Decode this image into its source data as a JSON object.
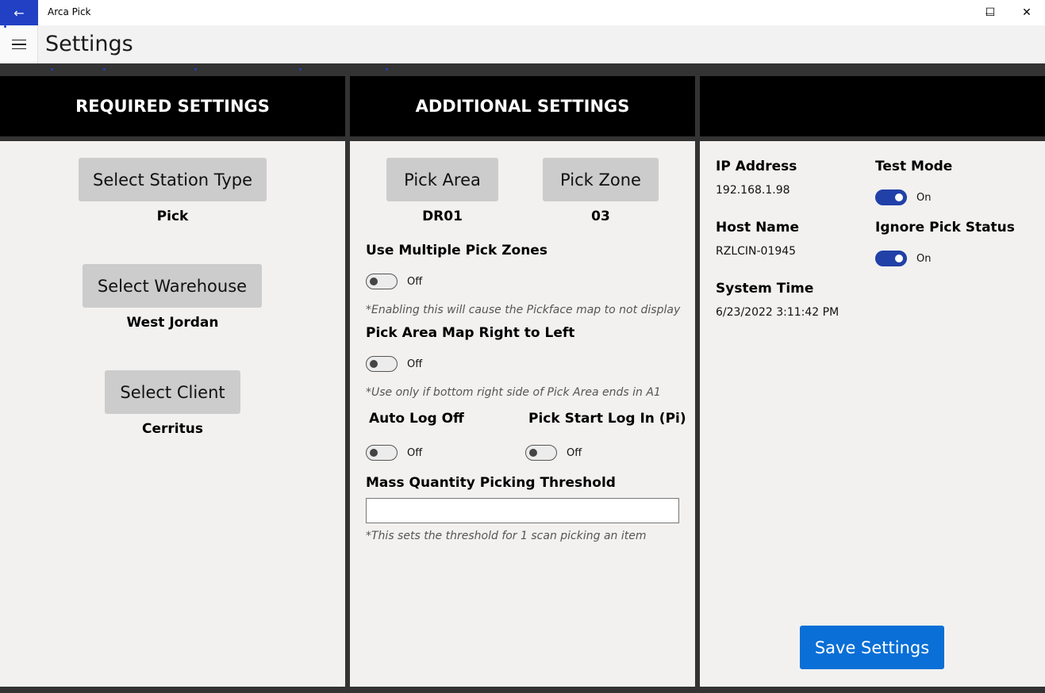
{
  "window": {
    "app_title": "Arca Pick",
    "back_icon": "arrow-left-icon",
    "minimize_icon": "minimize-icon",
    "maximize_icon": "maximize-icon",
    "close_icon": "close-icon",
    "back_glyph": "←",
    "minimize_glyph": "—",
    "maximize_glyph": "☐",
    "close_glyph": "✕"
  },
  "header": {
    "menu_icon": "hamburger-icon",
    "title": "Settings"
  },
  "required": {
    "heading": "REQUIRED SETTINGS",
    "station_type": {
      "button": "Select Station Type",
      "value": "Pick"
    },
    "warehouse": {
      "button": "Select Warehouse",
      "value": "West Jordan"
    },
    "client": {
      "button": "Select Client",
      "value": "Cerritus"
    }
  },
  "additional": {
    "heading": "ADDITIONAL SETTINGS",
    "pick_area": {
      "button": "Pick Area",
      "value": "DR01"
    },
    "pick_zone": {
      "button": "Pick Zone",
      "value": "03"
    },
    "multiple_zones": {
      "label": "Use Multiple Pick Zones",
      "state": "Off",
      "on": false,
      "note": "*Enabling this will cause the Pickface map to not display"
    },
    "map_rtl": {
      "label": "Pick Area Map Right to Left",
      "state": "Off",
      "on": false,
      "note": "*Use only if bottom right side of Pick Area ends in A1"
    },
    "auto_log_off": {
      "label": "Auto Log Off",
      "state": "Off",
      "on": false
    },
    "pick_start_login": {
      "label": "Pick Start Log In (Pi)",
      "state": "Off",
      "on": false
    },
    "mass_threshold": {
      "label": "Mass Quantity Picking Threshold",
      "value": "",
      "placeholder": "",
      "note": "*This sets the threshold for 1 scan picking an item"
    }
  },
  "system": {
    "heading": "",
    "ip_label": "IP Address",
    "ip_value": "192.168.1.98",
    "host_label": "Host Name",
    "host_value": "RZLCIN-01945",
    "time_label": "System Time",
    "time_value": "6/23/2022 3:11:42 PM",
    "test_mode": {
      "label": "Test Mode",
      "state": "On",
      "on": true
    },
    "ignore_pick_status": {
      "label": "Ignore Pick Status",
      "state": "On",
      "on": true
    },
    "save_button": "Save Settings"
  },
  "colors": {
    "accent": "#2140c4",
    "toggle_on": "#2140a8",
    "save_button": "#0a6fd6"
  }
}
